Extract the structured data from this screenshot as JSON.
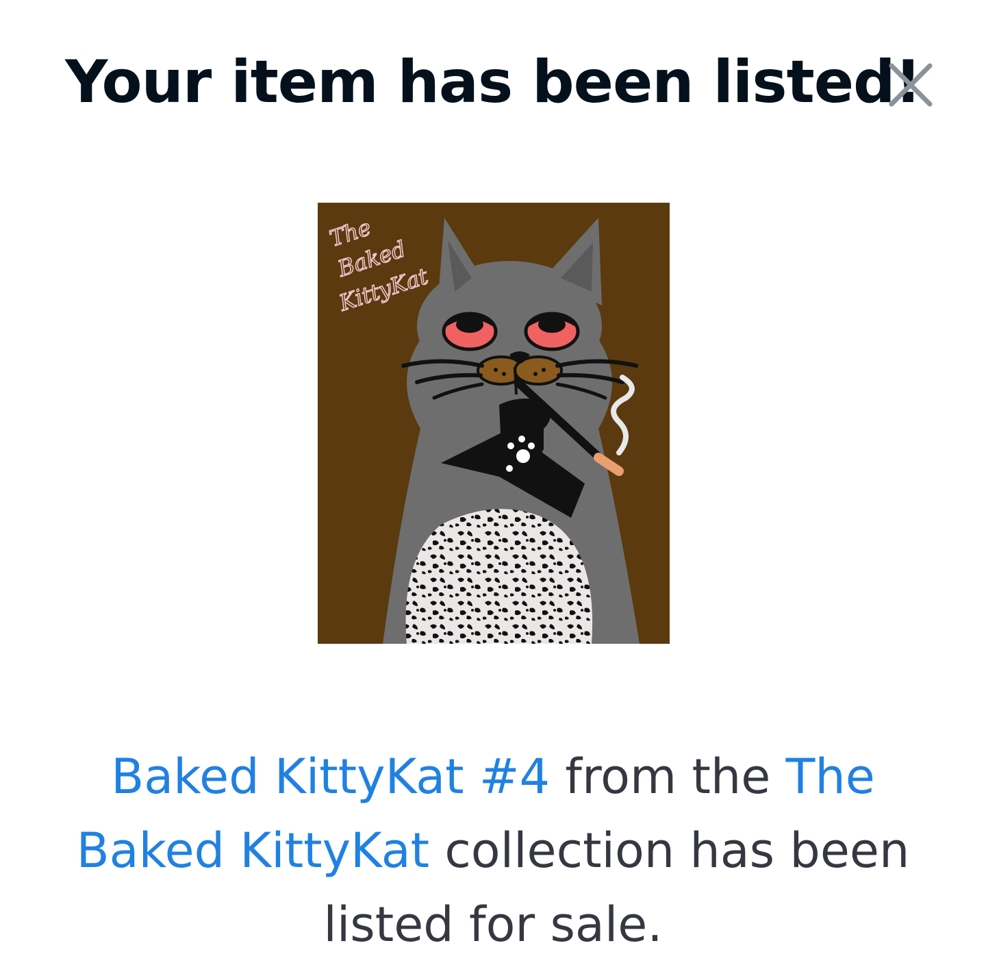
{
  "modal": {
    "title": "Your item has been listed!",
    "close_icon": "close-icon"
  },
  "item": {
    "artwork_icon": "cat-artwork-image",
    "artwork_text": [
      "The",
      "Baked",
      "KittyKat"
    ],
    "name": "Baked KittyKat #4",
    "collection_name": "The Baked KittyKat"
  },
  "message": {
    "text_from": " from the ",
    "text_suffix": " collection has been listed for sale."
  },
  "colors": {
    "title": "#04111d",
    "link": "#2081e2",
    "body_text": "#353840",
    "close_icon": "#8a939b",
    "artwork_background": "#5a3a0e",
    "cat_gray": "#6e6e6e",
    "eye_red": "#f06262"
  }
}
